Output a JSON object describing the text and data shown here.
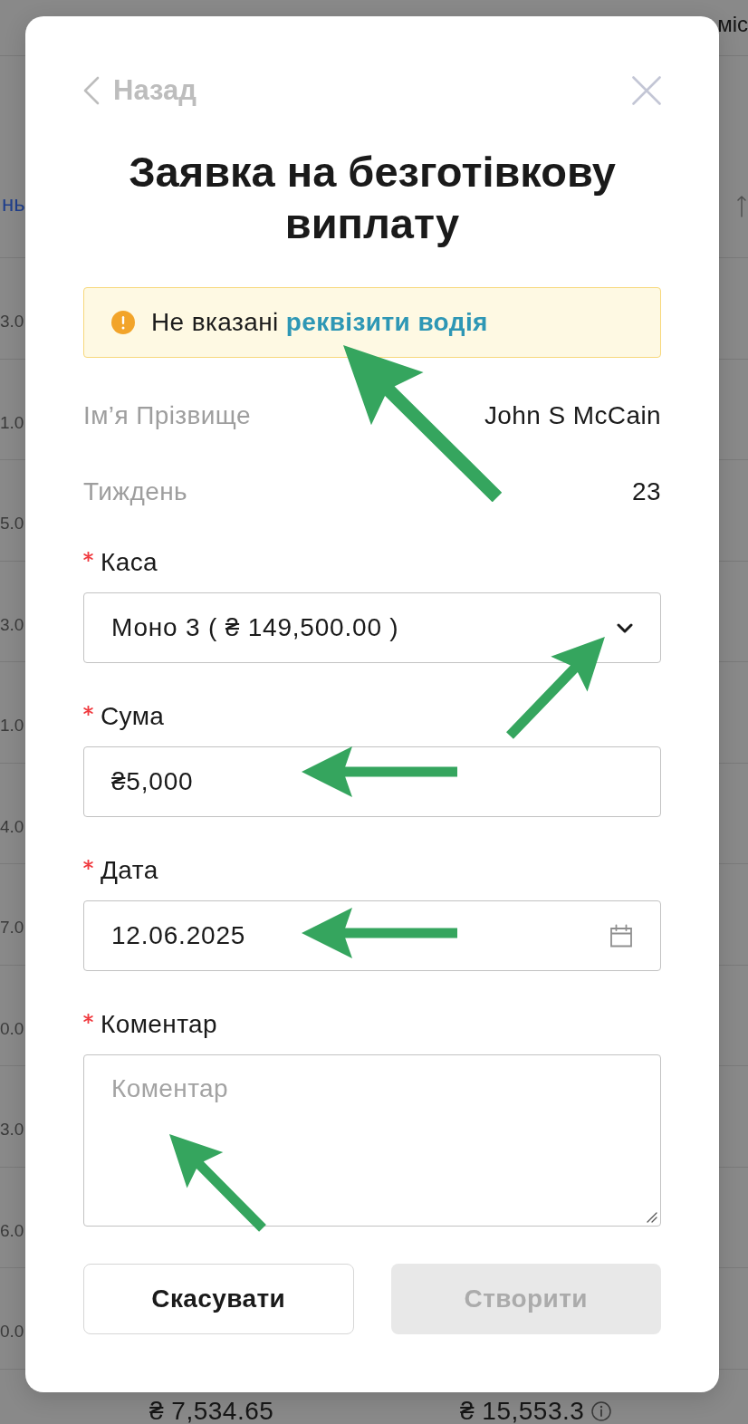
{
  "background": {
    "column_header": "міс",
    "column_link": "нь",
    "rows": [
      {
        "cell": "3.0"
      },
      {
        "cell": "1.0"
      },
      {
        "cell": "5.0"
      },
      {
        "cell": "3.0"
      },
      {
        "cell": "1.0"
      },
      {
        "cell": "4.0"
      },
      {
        "cell": "7.0"
      },
      {
        "cell": "0.0"
      },
      {
        "cell": "3.0"
      },
      {
        "cell": "6.0"
      },
      {
        "cell": "0.0"
      }
    ],
    "totals": [
      {
        "amount": "₴ 7,534.65"
      },
      {
        "amount": "₴ 15,553.3",
        "info": true
      }
    ]
  },
  "dialog": {
    "back_label": "Назад",
    "title": "Заявка на безготівкову виплату",
    "alert": {
      "text": "Не вказані",
      "link": "реквізити водія"
    },
    "details": [
      {
        "label": "Ім’я Прізвище",
        "value": "John S McCain"
      },
      {
        "label": "Тиждень",
        "value": "23"
      }
    ],
    "fields": [
      {
        "kind": "select",
        "label": "Каса",
        "required": true,
        "value": "Моно 3 ( ₴ 149,500.00 )"
      },
      {
        "kind": "number",
        "label": "Сума",
        "required": true,
        "value": "₴5,000"
      },
      {
        "kind": "date",
        "label": "Дата",
        "required": true,
        "value": "12.06.2025"
      },
      {
        "kind": "textarea",
        "label": "Коментар",
        "required": true,
        "placeholder": "Коментар"
      }
    ],
    "buttons": [
      {
        "kind": "secondary",
        "label": "Скасувати",
        "disabled": false
      },
      {
        "kind": "primary",
        "label": "Створити",
        "disabled": true
      }
    ]
  }
}
